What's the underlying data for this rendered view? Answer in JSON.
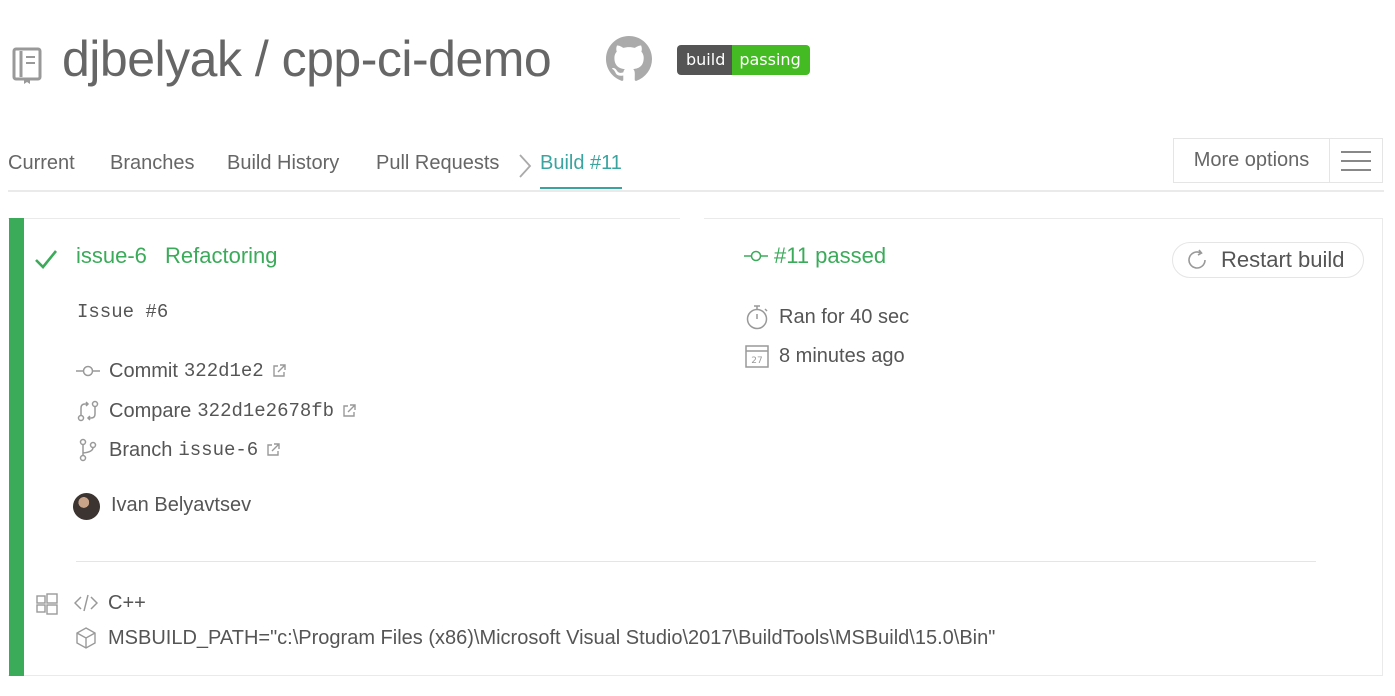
{
  "repo": {
    "title": "djbelyak / cpp-ci-demo",
    "badge_left": "build",
    "badge_right": "passing"
  },
  "tabs": {
    "current": "Current",
    "branches": "Branches",
    "build_history": "Build History",
    "pull_requests": "Pull Requests",
    "build": "Build #11",
    "more_options": "More options"
  },
  "build": {
    "branch": "issue-6",
    "commit_title": "Refactoring",
    "message": "Issue #6",
    "commit_label": "Commit",
    "commit_sha": "322d1e2",
    "compare_label": "Compare",
    "compare_sha": "322d1e2678fb",
    "branch_label": "Branch",
    "branch_value": "issue-6",
    "author": "Ivan Belyavtsev",
    "number_status": "#11 passed",
    "duration": "Ran for 40 sec",
    "finished": "8 minutes ago",
    "restart": "Restart build",
    "language": "C++",
    "env": "MSBUILD_PATH=\"c:\\Program Files (x86)\\Microsoft Visual Studio\\2017\\BuildTools\\MSBuild\\15.0\\Bin\""
  },
  "colors": {
    "passed": "#3bab5a",
    "active_tab": "#3aa5a0",
    "badge_green": "#44bb22",
    "badge_gray": "#555555"
  },
  "icons": {
    "repo": "repo-book-icon",
    "github": "github-icon",
    "check": "check-icon",
    "commit": "commit-icon",
    "compare": "compare-icon",
    "branch": "branch-icon",
    "external": "external-link-icon",
    "stopwatch": "stopwatch-icon",
    "calendar": "calendar-icon",
    "restart": "restart-icon",
    "windows": "windows-icon",
    "code": "code-icon",
    "package": "package-icon",
    "menu": "hamburger-icon"
  }
}
